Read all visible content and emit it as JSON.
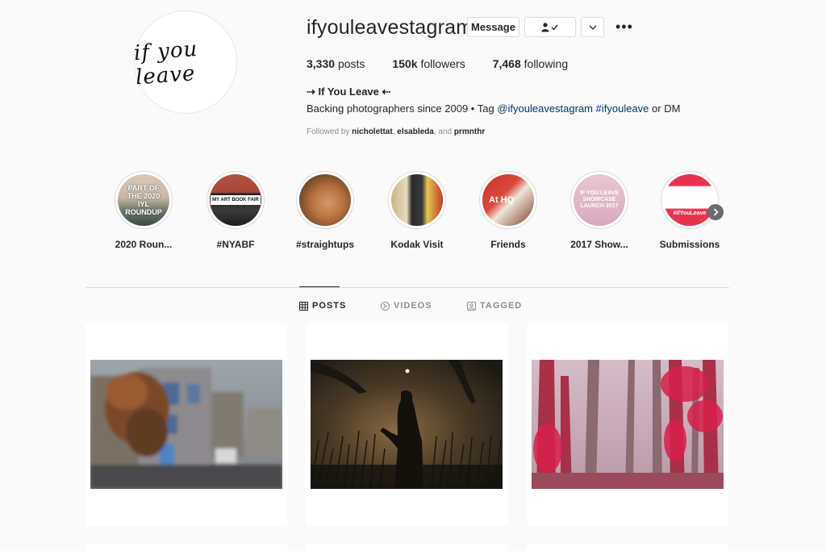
{
  "profile": {
    "avatar_text": "if you leave",
    "username": "ifyouleavestagram",
    "message_label": "Message",
    "caret_icon": "chevron-down-icon",
    "more_icon": "•••",
    "posts_count": "3,330",
    "posts_label": "posts",
    "followers_count": "150k",
    "followers_label": "followers",
    "following_count": "7,468",
    "following_label": "following",
    "bio_title": "⇢ If You Leave ⇠",
    "bio_prefix": "Backing photographers since 2009 • Tag ",
    "bio_link1": "@ifyouleavestagram",
    "bio_space": " ",
    "bio_link2": "#ifyouleave",
    "bio_suffix": " or DM",
    "followed_prefix": "Followed by ",
    "followed_user1": "nicholettat",
    "followed_sep1": ", ",
    "followed_user2": "elsableda",
    "followed_sep2": ", and ",
    "followed_user3": "prmnthr"
  },
  "highlights": [
    {
      "label": "2020 Roun...",
      "cover_text": "PART OF THE 2020 IYL ROUNDUP"
    },
    {
      "label": "#NYABF",
      "cover_text": "MY ART BOOK FAIR"
    },
    {
      "label": "#straightups",
      "cover_text": ""
    },
    {
      "label": "Kodak Visit",
      "cover_text": ""
    },
    {
      "label": "Friends",
      "cover_text": "At HQ"
    },
    {
      "label": "2017 Show...",
      "cover_text": "IF YOU LEAVE SHOWCASE LAUNCH 2017"
    },
    {
      "label": "Submissions",
      "cover_text": "#IfYouLeave"
    }
  ],
  "tabs": {
    "posts": "POSTS",
    "videos": "VIDEOS",
    "tagged": "TAGGED"
  },
  "colors": {
    "link": "#00376b",
    "border": "#dbdbdb",
    "muted": "#8e8e8e"
  }
}
